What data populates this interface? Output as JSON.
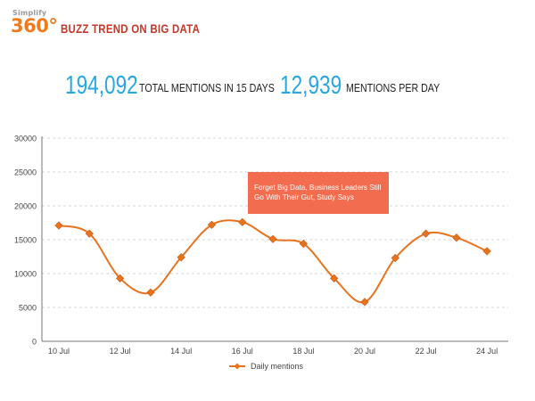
{
  "logo": {
    "top": "Simplify",
    "main": "360°"
  },
  "page_title": "BUZZ TREND ON BIG DATA",
  "stats": [
    {
      "value": "194,092",
      "label": "TOTAL MENTIONS IN 15 DAYS"
    },
    {
      "value": "12,939",
      "label": "MENTIONS PER DAY"
    }
  ],
  "colors": {
    "accent": "#29a8e0",
    "line": "#e8731f",
    "marker": "#e8731f",
    "callout": "#f26d4f",
    "title": "#c0392b"
  },
  "chart_data": {
    "type": "line",
    "title": "",
    "xlabel": "",
    "ylabel": "",
    "ylim": [
      0,
      30000
    ],
    "yticks": [
      0,
      5000,
      10000,
      15000,
      20000,
      25000,
      30000
    ],
    "x": [
      "10 Jul",
      "11 Jul",
      "12 Jul",
      "13 Jul",
      "14 Jul",
      "15 Jul",
      "16 Jul",
      "17 Jul",
      "18 Jul",
      "19 Jul",
      "20 Jul",
      "21 Jul",
      "22 Jul",
      "23 Jul",
      "24 Jul"
    ],
    "xtick_labels": [
      "10 Jul",
      "12 Jul",
      "14 Jul",
      "16 Jul",
      "18 Jul",
      "20 Jul",
      "22 Jul",
      "24 Jul"
    ],
    "series": [
      {
        "name": "Daily mentions",
        "values": [
          17100,
          15900,
          9300,
          7200,
          12400,
          17200,
          17600,
          15100,
          14400,
          9300,
          5800,
          12300,
          15900,
          15300,
          13300
        ]
      }
    ],
    "annotation": {
      "text_line1": "Forget Big Data, Business Leaders Still",
      "text_line2": "Go With Their Gut, Study Says",
      "at_x": "16 Jul"
    },
    "grid": true,
    "legend_position": "bottom"
  }
}
